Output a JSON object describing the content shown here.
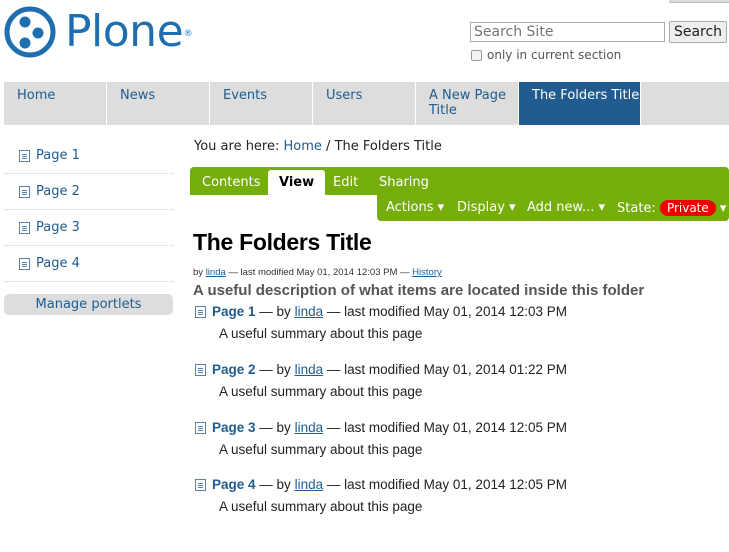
{
  "logo": {
    "text": "Plone",
    "mark": "®"
  },
  "search": {
    "placeholder": "Search Site",
    "button_label": "Search",
    "option_label": "only in current section"
  },
  "globalnav": {
    "tabs": [
      {
        "label": "Home"
      },
      {
        "label": "News"
      },
      {
        "label": "Events"
      },
      {
        "label": "Users"
      },
      {
        "label": "A New Page Title"
      },
      {
        "label": "The Folders Title",
        "selected": true
      }
    ]
  },
  "portlet": {
    "items": [
      {
        "label": "Page 1",
        "icon": "page-icon"
      },
      {
        "label": "Page 2",
        "icon": "page-icon"
      },
      {
        "label": "Page 3",
        "icon": "page-icon"
      },
      {
        "label": "Page 4",
        "icon": "page-icon"
      }
    ],
    "manage_label": "Manage portlets"
  },
  "breadcrumb": {
    "prefix": "You are here:",
    "home": "Home",
    "separator": "/",
    "current": "The Folders Title"
  },
  "editbar": {
    "tabs": [
      "Contents",
      "View",
      "Edit",
      "Sharing"
    ],
    "active_tab": "View",
    "actions_label": "Actions ▾",
    "display_label": "Display ▾",
    "addnew_label": "Add new... ▾",
    "state_label": "State:",
    "state_value": "Private",
    "state_arrow": "▾",
    "colors": {
      "bar": "#75ad0a",
      "state": "#ee0000"
    }
  },
  "document": {
    "title": "The Folders Title",
    "byline": {
      "by": "by",
      "author": "linda",
      "modified": "— last modified May 01, 2014 12:03 PM —",
      "history": "History"
    },
    "description": "A useful description of what items are located inside this folder"
  },
  "items": [
    {
      "title": "Page 1",
      "by": "— by",
      "author": "linda",
      "modified": "— last modified May 01, 2014 12:03 PM",
      "summary": "A useful summary about this page"
    },
    {
      "title": "Page 2",
      "by": "— by",
      "author": "linda",
      "modified": "— last modified May 01, 2014 01:22 PM",
      "summary": "A useful summary about this page"
    },
    {
      "title": "Page 3",
      "by": "— by",
      "author": "linda",
      "modified": "— last modified May 01, 2014 12:05 PM",
      "summary": "A useful summary about this page"
    },
    {
      "title": "Page 4",
      "by": "— by",
      "author": "linda",
      "modified": "— last modified May 01, 2014 12:05 PM",
      "summary": "A useful summary about this page"
    }
  ]
}
